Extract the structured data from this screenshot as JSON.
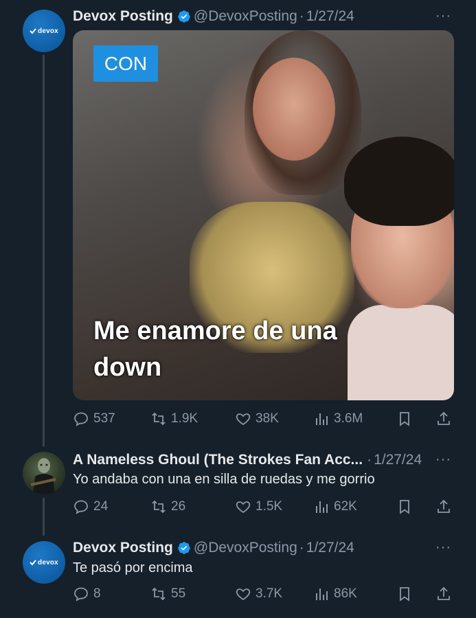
{
  "tweets": [
    {
      "name": "Devox Posting",
      "handle": "@DevoxPosting",
      "separator": "·",
      "date": "1/27/24",
      "avatar_text": "devox",
      "media": {
        "badge": "CON",
        "caption_line1": "Me enamore de una",
        "caption_line2": "down"
      },
      "stats": {
        "replies": "537",
        "reposts": "1.9K",
        "likes": "38K",
        "views": "3.6M"
      }
    },
    {
      "name": "A Nameless Ghoul (The Strokes Fan Acc...",
      "separator": "·",
      "date": "1/27/24",
      "text": "Yo andaba con una en silla de ruedas y me gorrio",
      "stats": {
        "replies": "24",
        "reposts": "26",
        "likes": "1.5K",
        "views": "62K"
      }
    },
    {
      "name": "Devox Posting",
      "handle": "@DevoxPosting",
      "separator": "·",
      "date": "1/27/24",
      "avatar_text": "devox",
      "text": "Te pasó por encima",
      "stats": {
        "replies": "8",
        "reposts": "55",
        "likes": "3.7K",
        "views": "86K"
      }
    }
  ],
  "more_label": "···",
  "colors": {
    "background": "#15202b",
    "verified": "#1d9bf0",
    "muted": "#8b98a5",
    "badge": "#1f8fe0"
  }
}
